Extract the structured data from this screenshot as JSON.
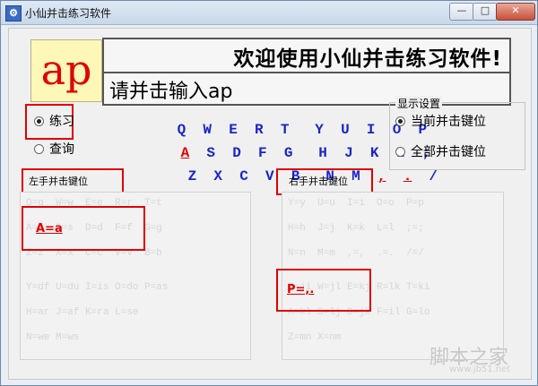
{
  "window": {
    "title": "小仙并击练习软件",
    "icon": "app-icon",
    "buttons": {
      "minimize": "—",
      "maximize": "□",
      "close": "✕"
    }
  },
  "display": {
    "letters": "ap",
    "welcome": "欢迎使用小仙并击练习软件!",
    "prompt": "请并击输入ap"
  },
  "mode": {
    "practice_label": "练习",
    "query_label": "查询",
    "selected": "practice"
  },
  "keyboard": {
    "row1": [
      "Q",
      "W",
      "E",
      "R",
      "T",
      "Y",
      "U",
      "I",
      "O",
      "P"
    ],
    "row2": [
      "A",
      "S",
      "D",
      "F",
      "G",
      "H",
      "J",
      "K",
      "L",
      ";"
    ],
    "row3": [
      "Z",
      "X",
      "C",
      "V",
      "B",
      "N",
      "M",
      ",",
      ".",
      "/"
    ],
    "highlight_color": "#e00000",
    "key_color": "#1a25c8"
  },
  "display_settings": {
    "title": "显示设置",
    "option_current": "当前并击键位",
    "option_all": "全部并击键位",
    "selected": "current"
  },
  "left_panel": {
    "label": "左手并击键位",
    "current_pair": "A=a",
    "faint_rows": [
      "Q=q  W=w  E=e  R=r  T=t",
      "A=a  S=s  D=d  F=f  G=g",
      "Z=z  X=x  C=c  V=v  B=b",
      "Y=df U=du I=is O=do P=as",
      "H=ar J=af K=ra L=se",
      "N=we M=ws"
    ]
  },
  "right_panel": {
    "label": "右手并击键位",
    "current_pair": "P=,.",
    "faint_rows": [
      "Y=y  U=u  I=i  O=o  P=p",
      "H=h  J=j  K=k  L=l  ;=;",
      "N=n  M=m  ,=,  .=.  /=/",
      "Q=ji W=jl E=kj R=lk T=ki",
      "A=kl S=lj D=jk F=il G=lo",
      "Z=mn X=nm"
    ]
  },
  "watermark": {
    "text": "脚本之家",
    "sub": "www.jb51.net"
  }
}
